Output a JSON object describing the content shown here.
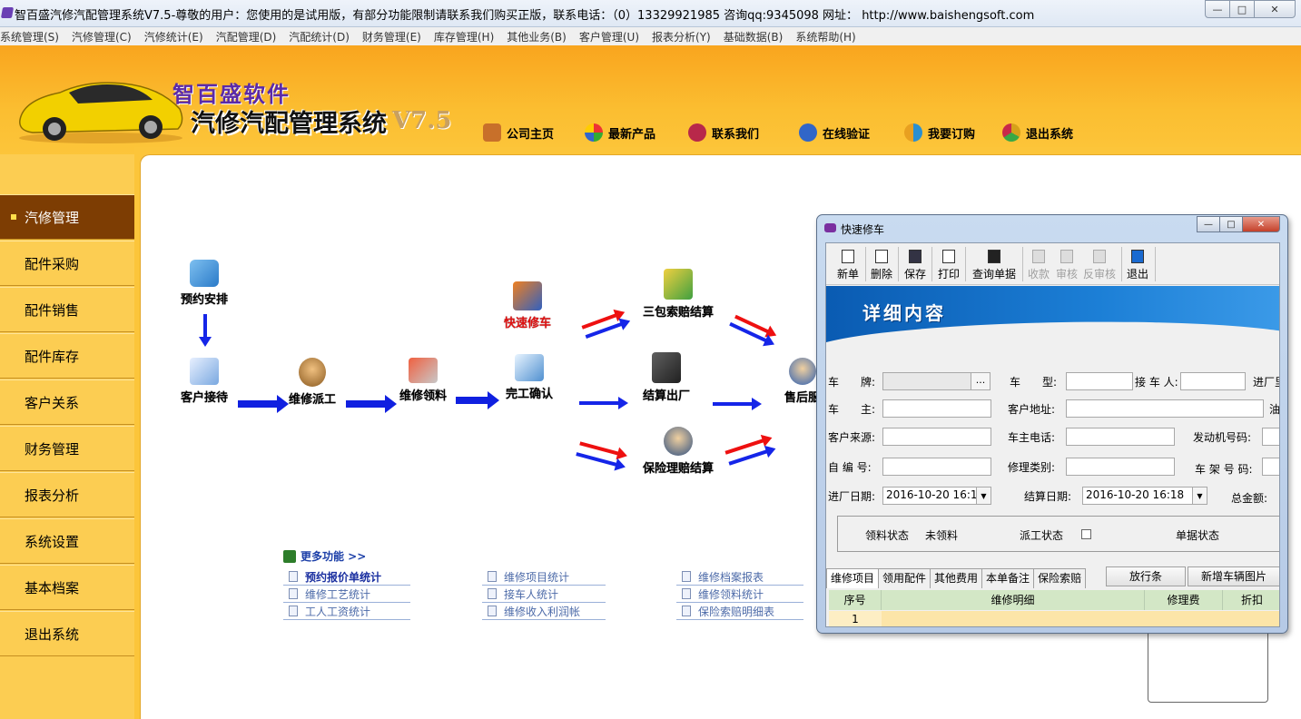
{
  "window": {
    "title": "智百盛汽修汽配管理系统V7.5-尊敬的用户：您使用的是试用版，有部分功能限制请联系我们购买正版，联系电话：（0）13329921985  咨询qq:9345098   网址： http://www.baishengsoft.com",
    "btn_min": "—",
    "btn_max": "□",
    "btn_close": "✕"
  },
  "menu": [
    "系统管理(S)",
    "汽修管理(C)",
    "汽修统计(E)",
    "汽配管理(D)",
    "汽配统计(D)",
    "财务管理(E)",
    "库存管理(H)",
    "其他业务(B)",
    "客户管理(U)",
    "报表分析(Y)",
    "基础数据(B)",
    "系统帮助(H)"
  ],
  "banner": {
    "brand_name": "智百盛软件",
    "brand_system": "汽修汽配管理系统",
    "brand_version": "V7.5",
    "nav": [
      {
        "label": "公司主页",
        "icon": "home-icon",
        "color": "#c8702a"
      },
      {
        "label": "最新产品",
        "icon": "colorwheel-icon",
        "color": "#39a845"
      },
      {
        "label": "联系我们",
        "icon": "heart-icon",
        "color": "#b8284a"
      },
      {
        "label": "在线验证",
        "icon": "link-icon",
        "color": "#3166c8"
      },
      {
        "label": "我要订购",
        "icon": "cart-icon",
        "color": "#2a8fd0"
      },
      {
        "label": "退出系统",
        "icon": "exit-icon",
        "color": "#d6a11a"
      }
    ]
  },
  "sidebar": [
    {
      "label": "汽修管理",
      "active": true
    },
    {
      "label": "配件采购"
    },
    {
      "label": "配件销售"
    },
    {
      "label": "配件库存"
    },
    {
      "label": "客户关系"
    },
    {
      "label": "财务管理"
    },
    {
      "label": "报表分析"
    },
    {
      "label": "系统设置"
    },
    {
      "label": "基本档案"
    },
    {
      "label": "退出系统"
    }
  ],
  "flow": {
    "yuyue": "预约安排",
    "jiedai": "客户接待",
    "paigong": "维修派工",
    "lingliao": "维修领料",
    "wangong": "完工确认",
    "kuaisu": "快速修车",
    "sanbao": "三包索赔结算",
    "jiesuan": "结算出厂",
    "baoxian": "保险理赔结算",
    "shouhou": "售后服"
  },
  "more": {
    "title": "更多功能 >>",
    "links": [
      {
        "label": "预约报价单统计",
        "bold": true
      },
      {
        "label": "维修项目统计"
      },
      {
        "label": "维修档案报表"
      },
      {
        "label": "维修工艺统计"
      },
      {
        "label": "接车人统计"
      },
      {
        "label": "维修领料统计"
      },
      {
        "label": "工人工资统计"
      },
      {
        "label": "维修收入利润帐"
      },
      {
        "label": "保险索赔明细表"
      }
    ]
  },
  "dialog": {
    "title": "快速修车",
    "toolbar": [
      {
        "label": "新单",
        "enabled": true
      },
      {
        "label": "删除",
        "enabled": true
      },
      {
        "label": "保存",
        "enabled": true
      },
      {
        "label": "打印",
        "enabled": true
      },
      {
        "label": "查询单据",
        "enabled": true
      },
      {
        "label": "收款",
        "enabled": false
      },
      {
        "label": "审核",
        "enabled": false
      },
      {
        "label": "反审核",
        "enabled": false
      },
      {
        "label": "退出",
        "enabled": true
      }
    ],
    "detail_title": "详细内容",
    "fields": {
      "chepai_label": "车　　牌:",
      "chepai_btn": "...",
      "chexing_label": "车　　型:",
      "jieche_label": "接 车 人:",
      "jinchang_label": "进厂里",
      "chezhu_label": "车　　主:",
      "kehudizhi_label": "客户地址:",
      "you_label": "油",
      "laiyuan_label": "客户来源:",
      "dianhua_label": "车主电话:",
      "fadongji_label": "发动机号码:",
      "zibian_label": "自 编 号:",
      "leibie_label": "修理类别:",
      "chejia_label": "车 架 号 码:",
      "jinchang_date_label": "进厂日期:",
      "jinchang_date_value": "2016-10-20 16:18",
      "jiesuan_date_label": "结算日期:",
      "jiesuan_date_value": "2016-10-20 16:18",
      "zongjine_label": "总金额:"
    },
    "status": {
      "lingliao_label": "领料状态",
      "lingliao_value": "未领料",
      "paigong_label": "派工状态",
      "danju_label": "单据状态"
    },
    "tabs": [
      "维修项目",
      "领用配件",
      "其他费用",
      "本单备注",
      "保险索赔"
    ],
    "tab_btn1": "放行条",
    "tab_btn2": "新增车辆图片",
    "grid": {
      "headers": [
        "序号",
        "维修明细",
        "修理费",
        "折扣"
      ],
      "row1": "1"
    }
  }
}
